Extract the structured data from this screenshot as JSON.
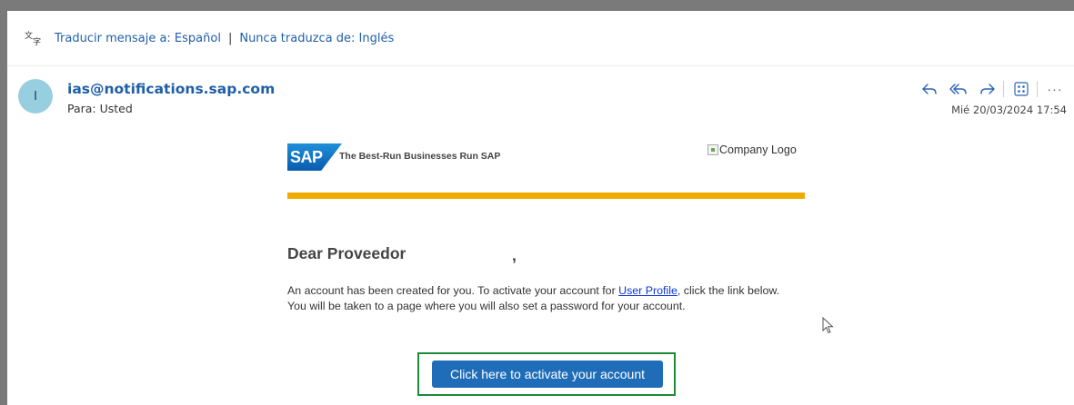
{
  "translate_bar": {
    "translate_link": "Traducir mensaje a: Español",
    "separator": "|",
    "never_translate_link": "Nunca traduzca de: Inglés"
  },
  "header": {
    "avatar_initial": "I",
    "sender": "ias@notifications.sap.com",
    "recipient": "Para:  Usted",
    "datetime": "Mié 20/03/2024 17:54",
    "more_label": "···"
  },
  "icons": {
    "translate": "translate-icon",
    "reply": "reply-icon",
    "reply_all": "reply-all-icon",
    "forward": "forward-icon",
    "apps": "apps-icon",
    "more": "more-icon"
  },
  "email": {
    "sap_logo": "SAP",
    "tagline": "The Best-Run Businesses Run SAP",
    "company_logo_alt": "Company Logo",
    "greeting": "Dear Proveedor",
    "greeting_comma": ",",
    "paragraph_before_link": "An account has been created for you. To activate your account for ",
    "link_text": "User Profile",
    "paragraph_after_link": ", click the link below. You will be taken to a page where you will also set a password for your account.",
    "cta_label": "Click here to activate your account"
  },
  "colors": {
    "link_blue": "#1f5fa8",
    "sap_orange": "#f0ab00",
    "cta_blue": "#1f6db8",
    "highlight_green": "#1e8a3a"
  }
}
